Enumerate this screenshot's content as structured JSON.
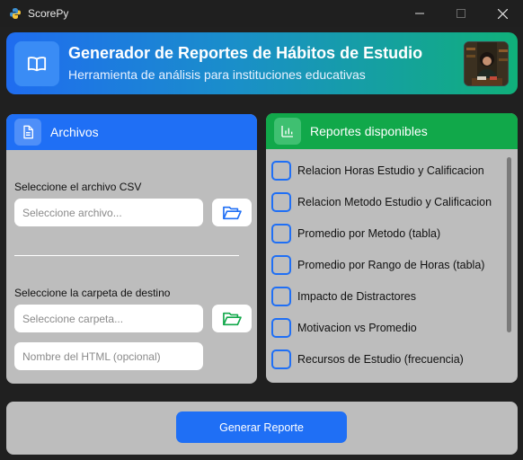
{
  "window": {
    "title": "ScorePy",
    "icon": "python-icon"
  },
  "header": {
    "title": "Generador de Reportes de Hábitos de Estudio",
    "subtitle": "Herramienta de análisis para instituciones educativas",
    "icon": "book-icon"
  },
  "files_panel": {
    "title": "Archivos",
    "icon": "document-icon",
    "csv_label": "Seleccione el archivo CSV",
    "csv_placeholder": "Seleccione archivo...",
    "dest_label": "Seleccione la carpeta de destino",
    "dest_placeholder": "Seleccione carpeta...",
    "html_placeholder": "Nombre del HTML (opcional)"
  },
  "reports_panel": {
    "title": "Reportes disponibles",
    "icon": "bar-chart-icon",
    "items": [
      {
        "label": "Relacion Horas Estudio y Calificacion",
        "checked": false
      },
      {
        "label": "Relacion Metodo Estudio y Calificacion",
        "checked": false
      },
      {
        "label": "Promedio por Metodo (tabla)",
        "checked": false
      },
      {
        "label": "Promedio por Rango de Horas (tabla)",
        "checked": false
      },
      {
        "label": "Impacto de Distractores",
        "checked": false
      },
      {
        "label": "Motivacion vs Promedio",
        "checked": false
      },
      {
        "label": "Recursos de Estudio (frecuencia)",
        "checked": false
      }
    ]
  },
  "footer": {
    "generate_label": "Generar Reporte"
  },
  "colors": {
    "primary_blue": "#1f6ff5",
    "primary_green": "#11a84a",
    "panel_bg": "#bdbdbd",
    "window_bg": "#202020"
  }
}
